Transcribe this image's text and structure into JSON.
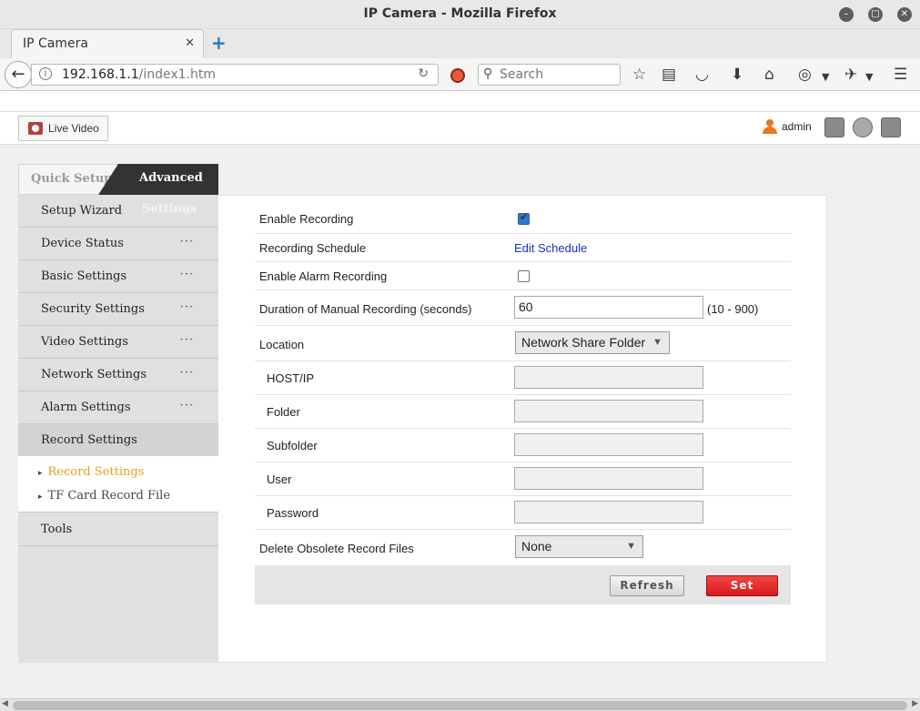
{
  "window": {
    "title": "IP Camera - Mozilla Firefox"
  },
  "browser": {
    "tab_label": "IP Camera",
    "url_host": "192.168.1.1",
    "url_path": "/index1.htm",
    "search_placeholder": "Search"
  },
  "header": {
    "live_video_label": "Live Video",
    "user_label": "admin"
  },
  "sidebar": {
    "tab_quick": "Quick Setup",
    "tab_advanced": "Advanced",
    "tab_advanced_line2": "Settings",
    "items": [
      {
        "label": "Setup Wizard",
        "dots": ""
      },
      {
        "label": "Device Status",
        "dots": "···"
      },
      {
        "label": "Basic Settings",
        "dots": "···"
      },
      {
        "label": "Security Settings",
        "dots": "···"
      },
      {
        "label": "Video Settings",
        "dots": "···"
      },
      {
        "label": "Network Settings",
        "dots": "···"
      },
      {
        "label": "Alarm Settings",
        "dots": "···"
      },
      {
        "label": "Record Settings",
        "dots": ""
      },
      {
        "label": "Tools",
        "dots": ""
      }
    ],
    "subitems": [
      {
        "label": "Record Settings"
      },
      {
        "label": "TF Card Record File"
      }
    ]
  },
  "form": {
    "enable_recording": {
      "label": "Enable Recording",
      "checked": true
    },
    "recording_schedule": {
      "label": "Recording Schedule",
      "link": "Edit Schedule"
    },
    "enable_alarm_recording": {
      "label": "Enable Alarm Recording",
      "checked": false
    },
    "manual_duration": {
      "label": "Duration of Manual Recording (seconds)",
      "value": "60",
      "range": "(10 - 900)"
    },
    "location": {
      "label": "Location",
      "value": "Network Share Folder"
    },
    "host_ip": {
      "label": "HOST/IP",
      "value": ""
    },
    "folder": {
      "label": "Folder",
      "value": ""
    },
    "subfolder": {
      "label": "Subfolder",
      "value": ""
    },
    "user": {
      "label": "User",
      "value": ""
    },
    "password": {
      "label": "Password",
      "value": ""
    },
    "delete_obsolete": {
      "label": "Delete Obsolete Record Files",
      "value": "None"
    }
  },
  "buttons": {
    "refresh": "Refresh",
    "set": "Set"
  },
  "colors": {
    "accent_orange": "#e8a020",
    "set_red": "#e02020",
    "link_blue": "#1a2fc7",
    "sidebar_dark": "#333333"
  }
}
